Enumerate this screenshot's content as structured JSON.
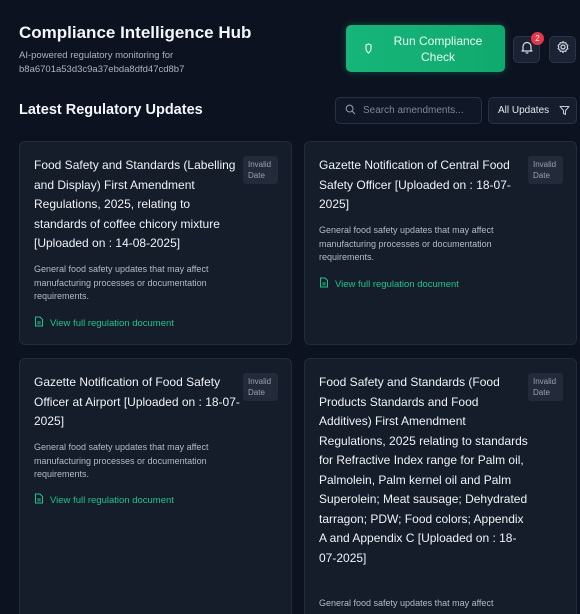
{
  "header": {
    "title": "Compliance Intelligence Hub",
    "subtitle": "AI-powered regulatory monitoring for b8a6701a53d3c9a37ebda8dfd47cd8b7",
    "run_button": "Run Compliance Check",
    "notification_count": "2"
  },
  "section": {
    "title": "Latest Regulatory Updates",
    "search_placeholder": "Search amendments...",
    "filter_label": "All Updates"
  },
  "cards": [
    {
      "title": "Food Safety and Standards (Labelling and Display) First Amendment Regulations, 2025, relating to standards of coffee chicory mixture  [Uploaded on : 14-08-2025]",
      "date": "Invalid Date",
      "description": "General food safety updates that may affect manufacturing processes or documentation requirements.",
      "link": "View full regulation document"
    },
    {
      "title": "Gazette Notification of Central Food Safety Officer  [Uploaded on : 18-07-2025]",
      "date": "Invalid Date",
      "description": "General food safety updates that may affect manufacturing processes or documentation requirements.",
      "link": "View full regulation document"
    },
    {
      "title": "Gazette Notification of Food Safety Officer at Airport  [Uploaded on : 18-07-2025]",
      "date": "Invalid Date",
      "description": "General food safety updates that may affect manufacturing processes or documentation requirements.",
      "link": "View full regulation document"
    },
    {
      "title": "Food Safety and Standards (Food Products Standards and Food Additives) First Amendment Regulations, 2025 relating to standards for Refractive Index range for Palm oil, Palmolein, Palm kernel oil and Palm Superolein; Meat sausage; Dehydrated tarragon; PDW; Food colors; Appendix A and Appendix C  [Uploaded on : 18-07-2025]",
      "date": "Invalid Date",
      "description": "General food safety updates that may affect"
    }
  ],
  "colors": {
    "background": "#0c1220",
    "card": "#151c2a",
    "accent_green": "#10b981",
    "badge_red": "#e5364a"
  },
  "icons": [
    "shield-icon",
    "bell-icon",
    "gear-icon",
    "search-icon",
    "filter-icon",
    "document-icon"
  ]
}
